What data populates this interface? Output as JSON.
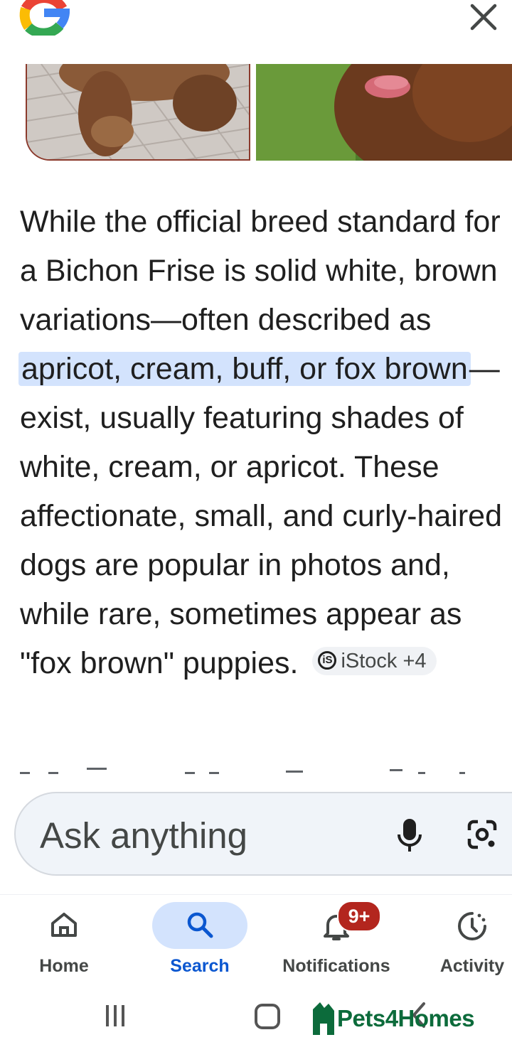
{
  "header": {
    "logo_icon": "google-g-icon",
    "close_icon": "close-icon"
  },
  "images": [
    {
      "name": "brown-bichon-paws-photo"
    },
    {
      "name": "brown-dog-tongue-photo"
    }
  ],
  "answer": {
    "part1": "While the official breed standard for a Bichon Frise is solid white, brown variations—often described as ",
    "highlight": "apricot, cream, buff, or fox brown",
    "part2": "—exist, usually featuring shades of white, cream, or apricot. These affectionate, small, and curly-haired dogs are popular in photos and, while rare, sometimes appear as \"fox brown\" puppies.",
    "source_chip": "iStock +4"
  },
  "search": {
    "placeholder": "Ask anything",
    "mic_icon": "microphone-icon",
    "lens_icon": "google-lens-icon"
  },
  "nav": {
    "items": [
      {
        "label": "Home",
        "icon": "home-icon"
      },
      {
        "label": "Search",
        "icon": "search-icon",
        "active": true
      },
      {
        "label": "Notifications",
        "icon": "bell-icon",
        "badge": "9+"
      },
      {
        "label": "Activity",
        "icon": "activity-icon"
      }
    ]
  },
  "watermark": {
    "text": "Pets4Homes"
  },
  "colors": {
    "highlight": "#d3e3fd",
    "active_blue": "#0b57d0",
    "badge_red": "#b3261e",
    "brand_green": "#0c6b3b"
  }
}
